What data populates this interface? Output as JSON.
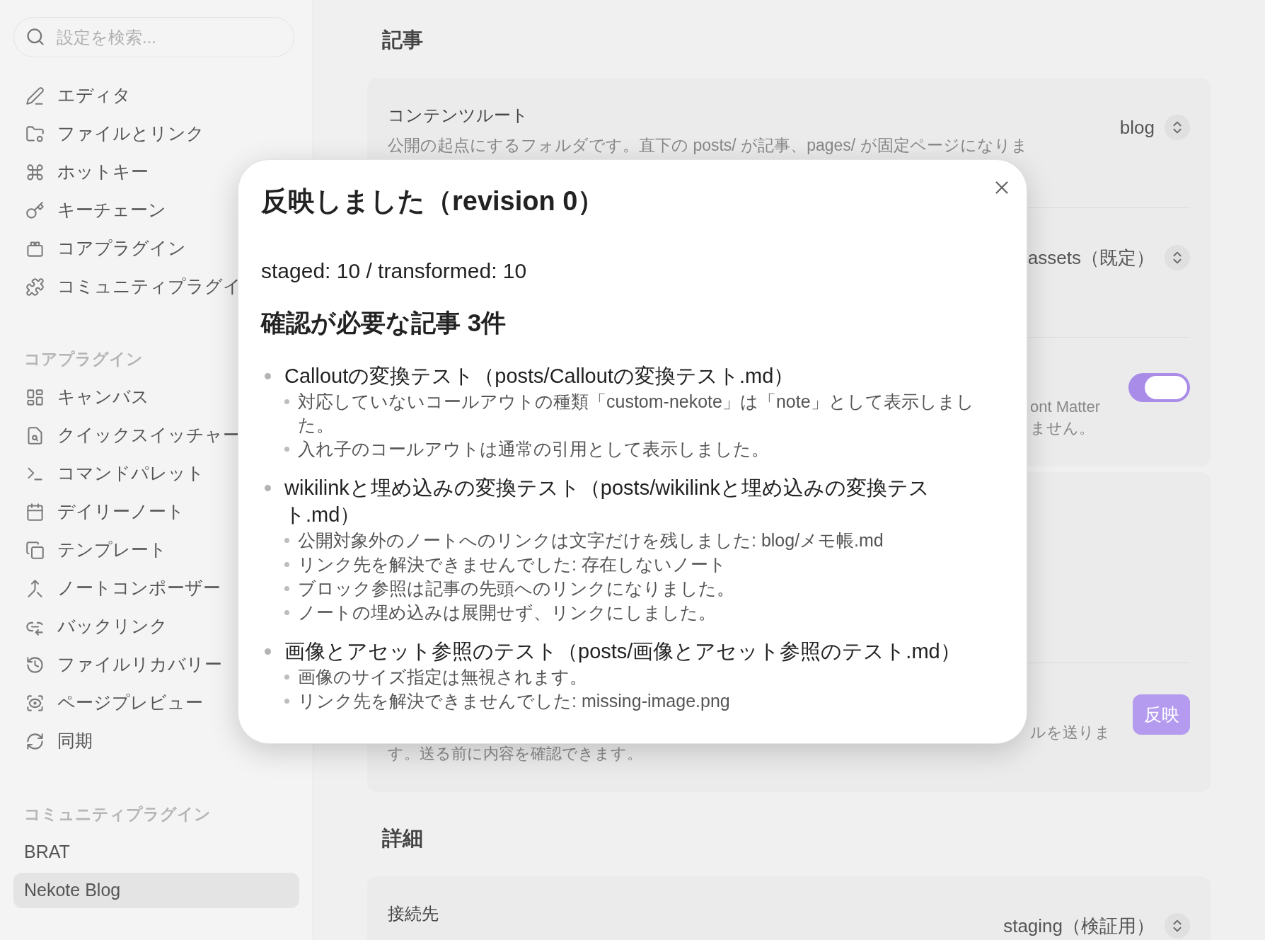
{
  "sidebar": {
    "search": {
      "placeholder": "設定を検索..."
    },
    "groups": [
      {
        "items": [
          {
            "label": "エディタ",
            "selected": false
          },
          {
            "label": "ファイルとリンク",
            "selected": false
          },
          {
            "label": "ホットキー",
            "selected": false
          },
          {
            "label": "キーチェーン",
            "selected": false
          },
          {
            "label": "コアプラグイン",
            "selected": false
          },
          {
            "label": "コミュニティプラグイ",
            "selected": false
          }
        ]
      },
      {
        "heading": "コアプラグイン",
        "items": [
          {
            "label": "キャンバス",
            "selected": false
          },
          {
            "label": "クイックスイッチャー",
            "selected": false
          },
          {
            "label": "コマンドパレット",
            "selected": false
          },
          {
            "label": "デイリーノート",
            "selected": false
          },
          {
            "label": "テンプレート",
            "selected": false
          },
          {
            "label": "ノートコンポーザー",
            "selected": false
          },
          {
            "label": "バックリンク",
            "selected": false
          },
          {
            "label": "ファイルリカバリー",
            "selected": false
          },
          {
            "label": "ページプレビュー",
            "selected": false
          },
          {
            "label": "同期",
            "selected": false
          }
        ]
      },
      {
        "heading": "コミュニティプラグイン",
        "items": [
          {
            "label": "BRAT",
            "selected": false
          },
          {
            "label": "Nekote Blog",
            "selected": true
          }
        ]
      }
    ]
  },
  "sections": [
    {
      "heading": "記事",
      "cards": [
        {
          "rows": [
            {
              "kind": "select",
              "label": "コンテンツルート",
              "description": "公開の起点にするフォルダです。直下の posts/ が記事、pages/ が固定ページになりま",
              "value": "blog"
            },
            {
              "kind": "select",
              "value": "assets（既定）"
            },
            {
              "kind": "toggle",
              "description_lines": [
                "ont Matter",
                "ません。"
              ],
              "on": true
            }
          ]
        },
        {
          "rows": [
            {
              "kind": "blank"
            },
            {
              "kind": "button",
              "description_lines": [
                "ルを送りま",
                "す。送る前に内容を確認できます。"
              ],
              "button": "反映"
            }
          ]
        }
      ]
    },
    {
      "heading": "詳細",
      "cards": [
        {
          "rows": [
            {
              "kind": "select",
              "label": "接続先",
              "value": "staging（検証用）"
            }
          ]
        }
      ]
    }
  ],
  "dialog": {
    "title": "反映しました（revision 0）",
    "summary": "staged: 10 / transformed: 10",
    "heading": "確認が必要な記事 3件",
    "articles": [
      {
        "title": "Calloutの変換テスト（posts/Calloutの変換テスト.md）",
        "notes": [
          "対応していないコールアウトの種類「custom-nekote」は「note」として表示しました。",
          "入れ子のコールアウトは通常の引用として表示しました。"
        ]
      },
      {
        "title": "wikilinkと埋め込みの変換テスト（posts/wikilinkと埋め込みの変換テスト.md）",
        "notes": [
          "公開対象外のノートへのリンクは文字だけを残しました: blog/メモ帳.md",
          "リンク先を解決できませんでした: 存在しないノート",
          "ブロック参照は記事の先頭へのリンクになりました。",
          "ノートの埋め込みは展開せず、リンクにしました。"
        ]
      },
      {
        "title": "画像とアセット参照のテスト（posts/画像とアセット参照のテスト.md）",
        "notes": [
          "画像のサイズ指定は無視されます。",
          "リンク先を解決できませんでした: missing-image.png"
        ]
      }
    ]
  }
}
